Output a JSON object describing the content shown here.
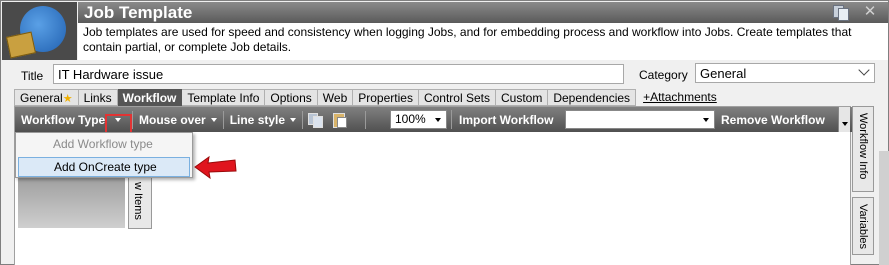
{
  "header": {
    "title": "Job Template",
    "description": "Job templates are used for speed and consistency when logging Jobs, and for embedding process and workflow into Jobs.  Create templates that contain partial, or complete Job details."
  },
  "form": {
    "title_label": "Title",
    "title_value": "IT Hardware issue",
    "category_label": "Category",
    "category_value": "General"
  },
  "tabs": [
    {
      "label": "General"
    },
    {
      "label": "Links"
    },
    {
      "label": "Workflow"
    },
    {
      "label": "Template Info"
    },
    {
      "label": "Options"
    },
    {
      "label": "Web"
    },
    {
      "label": "Properties"
    },
    {
      "label": "Control Sets"
    },
    {
      "label": "Custom"
    },
    {
      "label": "Dependencies"
    },
    {
      "label": "+Attachments"
    }
  ],
  "toolbar": {
    "workflow_type": "Workflow Type",
    "mouse_over": "Mouse over",
    "line_style": "Line style",
    "zoom": "100%",
    "import_workflow": "Import Workflow",
    "import_value": "",
    "remove_workflow": "Remove Workflow"
  },
  "dropdown": {
    "items": [
      {
        "label": "Add Workflow type",
        "disabled": true
      },
      {
        "label": "Add OnCreate type",
        "disabled": false
      }
    ]
  },
  "side_tabs": {
    "items": "w Items",
    "workflow_info": "Workflow Info",
    "variables": "Variables"
  },
  "colors": {
    "highlight": "#e23333",
    "arrow": "#e0151e",
    "active_tab": "#555555"
  }
}
